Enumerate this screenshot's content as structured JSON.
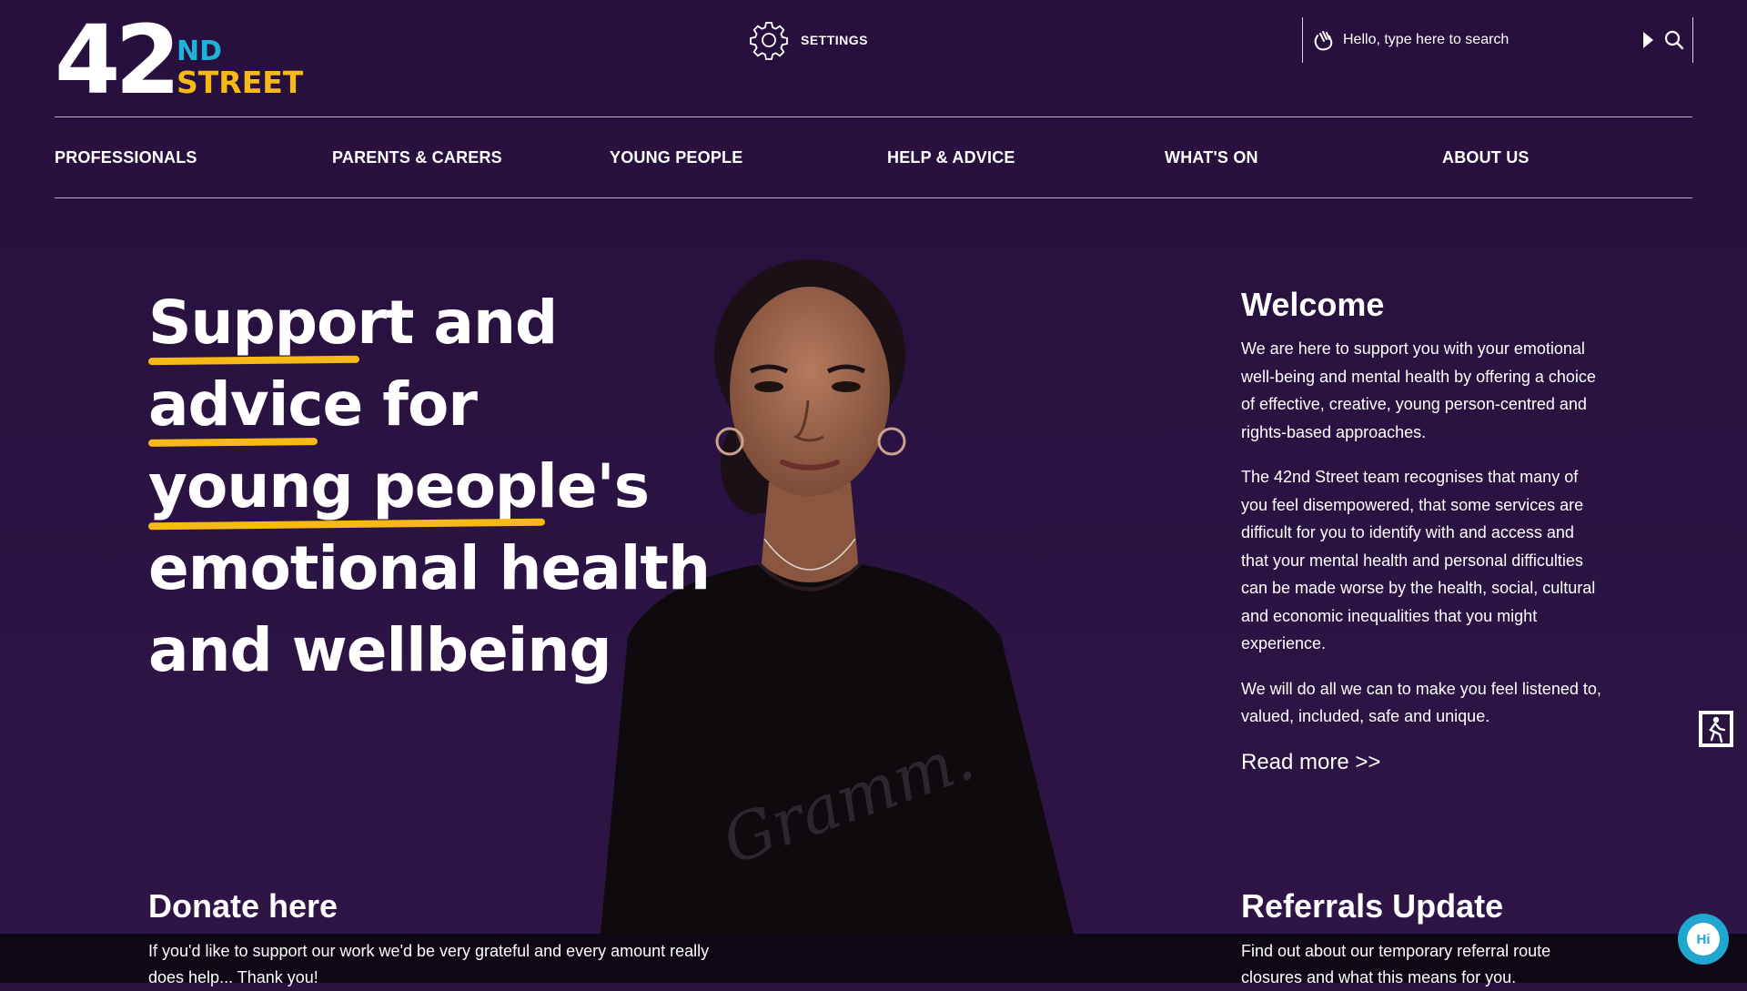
{
  "brand": {
    "logo_number": "42",
    "logo_nd": "ND",
    "logo_street": "STREET",
    "colors": {
      "background": "#2a1340",
      "accent_yellow": "#f7b915",
      "accent_blue": "#1fb2d9"
    }
  },
  "header": {
    "settings_label": "SETTINGS",
    "settings_icon": "gear-icon",
    "search_placeholder": "Hello, type here to search",
    "search_icons": [
      "wave-hand-icon",
      "play-icon",
      "search-icon"
    ]
  },
  "nav": {
    "items": [
      {
        "label": "PROFESSIONALS"
      },
      {
        "label": "PARENTS & CARERS"
      },
      {
        "label": "YOUNG PEOPLE"
      },
      {
        "label": "HELP & ADVICE"
      },
      {
        "label": "WHAT'S ON"
      },
      {
        "label": "ABOUT US"
      }
    ]
  },
  "hero": {
    "headline_lines": [
      "Support and",
      "advice for",
      "young people's",
      "emotional health",
      "and wellbeing"
    ],
    "image": "portrait-photo"
  },
  "welcome": {
    "title": "Welcome",
    "paragraphs": [
      "We are here to support you with your emotional well-being and mental health by offering a choice of effective, creative, young person-centred and rights-based approaches.",
      "The 42nd Street team recognises that many of you feel disempowered, that some services are difficult for you to identify with and access and that your mental health and personal difficulties can be made worse by the health, social, cultural and economic inequalities that you might experience.",
      "We will do all we can to make you feel listened to, valued, included, safe and unique."
    ],
    "read_more": "Read more >>"
  },
  "donate": {
    "title": "Donate here",
    "text": "If you'd like to support our work we'd be very grateful and every amount really does help... Thank you!"
  },
  "referrals": {
    "title": "Referrals Update",
    "text": "Find out about our temporary referral route closures and what this means for you."
  },
  "widgets": {
    "exit_icon": "quick-exit-icon",
    "chat_label": "Hi"
  }
}
